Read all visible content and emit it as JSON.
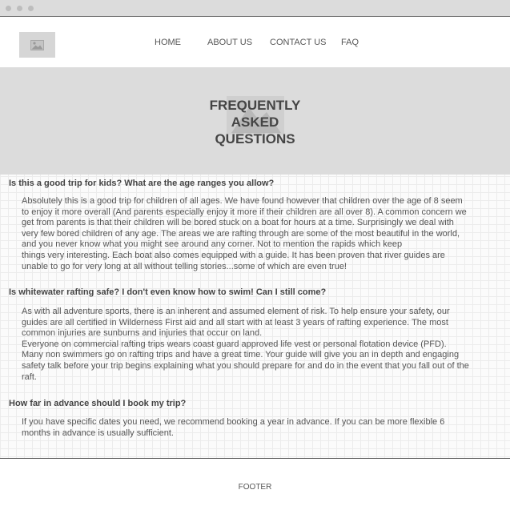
{
  "nav": {
    "items": [
      {
        "label": "HOME"
      },
      {
        "label": "ABOUT US"
      },
      {
        "label": "CONTACT US"
      },
      {
        "label": "FAQ"
      }
    ]
  },
  "hero": {
    "title_lines": [
      "FREQUENTLY",
      "ASKED",
      "QUESTIONS"
    ]
  },
  "faq": [
    {
      "question": "Is this a good trip for kids? What are the age ranges you allow?",
      "answer_lines": [
        "Absolutely this is a good trip for children of all ages. We have found however that children over the age of 8 seem",
        "to enjoy it more overall (And parents especially enjoy it more if their children are all over 8). A common concern we",
        "get from parents is that their children will be bored stuck on a boat for hours at a time. Surprisingly we deal with",
        "very few bored children of any age. The areas we are rafting through are some of the most beautiful in the world,",
        "and you never know what you might see around any corner. Not to mention the rapids which keep",
        "things very interesting. Each boat also comes equipped with a guide. It has been proven that river guides are",
        "unable to go for very long at all without telling stories...some of which are even true!"
      ]
    },
    {
      "question": "Is whitewater rafting safe? I don't even know how to swim! Can I still come?",
      "answer_lines": [
        "As with all adventure sports, there is an inherent and assumed element of risk. To help ensure your safety, our",
        "guides are all certified in Wilderness First aid and all start with at least 3 years of rafting experience. The most",
        "common injuries are sunburns and injuries that occur on land.",
        "Everyone on commercial rafting trips wears coast guard approved life vest or personal flotation device (PFD).",
        "Many non swimmers go on rafting trips and have a great time. Your guide will give you an in depth and engaging",
        "safety talk before your trip begins explaining what you should prepare for and do in the event that you fall out of the",
        "raft."
      ]
    },
    {
      "question": "How far in advance should I book my trip?",
      "answer_lines": [
        "If you have specific dates you need, we recommend booking a year in advance. If you can be more flexible 6",
        "months in advance is usually sufficient."
      ]
    }
  ],
  "footer": {
    "label": "FOOTER"
  },
  "icons": {
    "logo": "image-placeholder-icon",
    "hero_background": "image-placeholder-icon"
  }
}
